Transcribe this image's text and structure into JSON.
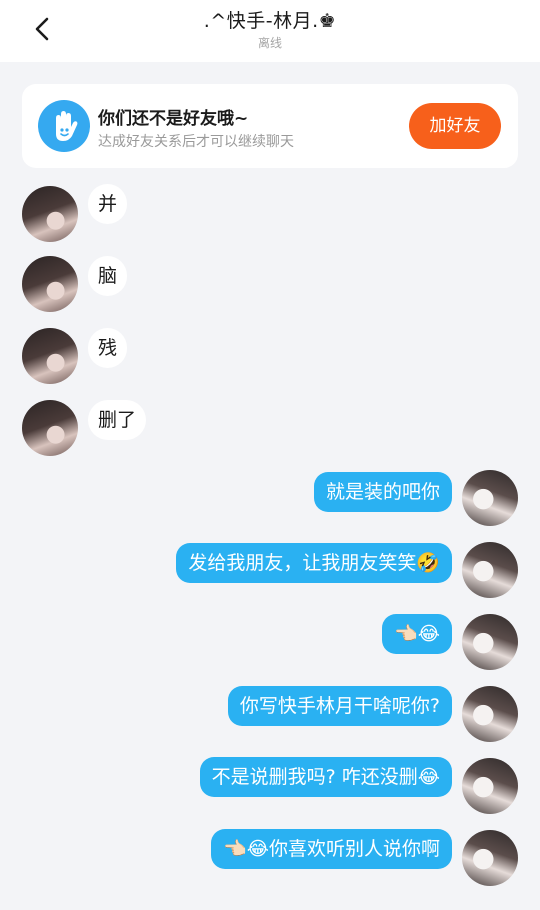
{
  "header": {
    "title": ".^快手-林月.♚",
    "status": "离线"
  },
  "friend_notice": {
    "title": "你们还不是好友哦~",
    "description": "达成好友关系后才可以继续聊天",
    "add_button_label": "加好友"
  },
  "messages": [
    {
      "side": "left",
      "text": "并"
    },
    {
      "side": "left",
      "text": "脑"
    },
    {
      "side": "left",
      "text": "残"
    },
    {
      "side": "left",
      "text": "删了"
    },
    {
      "side": "right",
      "text": "就是装的吧你"
    },
    {
      "side": "right",
      "text": "发给我朋友，让我朋友笑笑🤣"
    },
    {
      "side": "right",
      "text": "👈🏻😂"
    },
    {
      "side": "right",
      "text": "你写快手林月干啥呢你?"
    },
    {
      "side": "right",
      "text": "不是说删我吗? 咋还没删😂"
    },
    {
      "side": "right",
      "text": "👈🏻😂你喜欢听别人说你啊"
    }
  ],
  "colors": {
    "outgoing_bubble": "#2ab1f2",
    "add_button": "#f7601b",
    "hand_icon_bg": "#35a9f0"
  }
}
